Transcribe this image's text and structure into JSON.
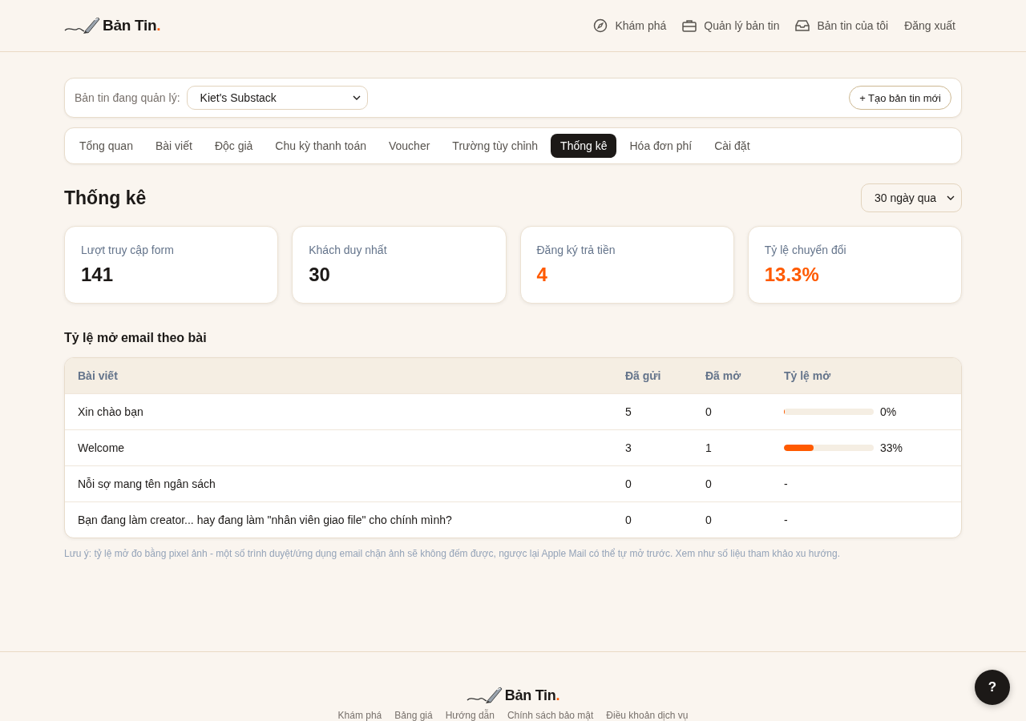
{
  "header": {
    "logo": {
      "text": "Bản Tin",
      "dot": "."
    },
    "nav": [
      {
        "label": "Khám phá"
      },
      {
        "label": "Quản lý bản tin"
      },
      {
        "label": "Bản tin của tôi"
      },
      {
        "label": "Đăng xuất"
      }
    ]
  },
  "manager": {
    "label": "Bản tin đang quản lý:",
    "value": "Kiet's Substack",
    "create_button": "+ Tạo bản tin mới"
  },
  "tabs": [
    {
      "label": "Tổng quan",
      "selected": false
    },
    {
      "label": "Bài viết",
      "selected": false
    },
    {
      "label": "Độc giả",
      "selected": false
    },
    {
      "label": "Chu kỳ thanh toán",
      "selected": false
    },
    {
      "label": "Voucher",
      "selected": false
    },
    {
      "label": "Trường tùy chỉnh",
      "selected": false
    },
    {
      "label": "Thống kê",
      "selected": true
    },
    {
      "label": "Hóa đơn phí",
      "selected": false
    },
    {
      "label": "Cài đặt",
      "selected": false
    }
  ],
  "page_title": "Thống kê",
  "period": "30 ngày qua",
  "stats": [
    {
      "label": "Lượt truy cập form",
      "value": "141",
      "highlight": false
    },
    {
      "label": "Khách duy nhất",
      "value": "30",
      "highlight": false
    },
    {
      "label": "Đăng ký trả tiền",
      "value": "4",
      "highlight": true
    },
    {
      "label": "Tỷ lệ chuyển đổi",
      "value": "13.3%",
      "highlight": true
    }
  ],
  "open_rate": {
    "title": "Tỷ lệ mở email theo bài",
    "columns": [
      "Bài viết",
      "Đã gửi",
      "Đã mở",
      "Tỷ lệ mở"
    ],
    "rows": [
      {
        "post": "Xin chào bạn",
        "sent": "5",
        "opened": "0",
        "kind": "bar",
        "level": 0,
        "reading": "0%"
      },
      {
        "post": "Welcome",
        "sent": "3",
        "opened": "1",
        "kind": "bar",
        "level": 0.33,
        "reading": "33%"
      },
      {
        "post": "Nỗi sợ mang tên ngân sách",
        "sent": "0",
        "opened": "0",
        "kind": "text",
        "reading": "-"
      },
      {
        "post": "Bạn đang làm creator... hay đang làm \"nhân viên giao file\" cho chính mình?",
        "sent": "0",
        "opened": "0",
        "kind": "text",
        "reading": "-"
      }
    ],
    "note": "Lưu ý: tỷ lệ mở đo bằng pixel ảnh - một số trình duyệt/ứng dụng email chặn ảnh sẽ không đếm được, ngược lại Apple Mail có thể tự mở trước. Xem như số liệu tham khảo xu hướng."
  },
  "footer": {
    "logo": {
      "text": "Bản Tin",
      "dot": "."
    },
    "links": [
      "Khám phá",
      "Bảng giá",
      "Hướng dẫn",
      "Chính sách bảo mật",
      "Điều khoản dịch vụ"
    ]
  },
  "help_button": "?"
}
